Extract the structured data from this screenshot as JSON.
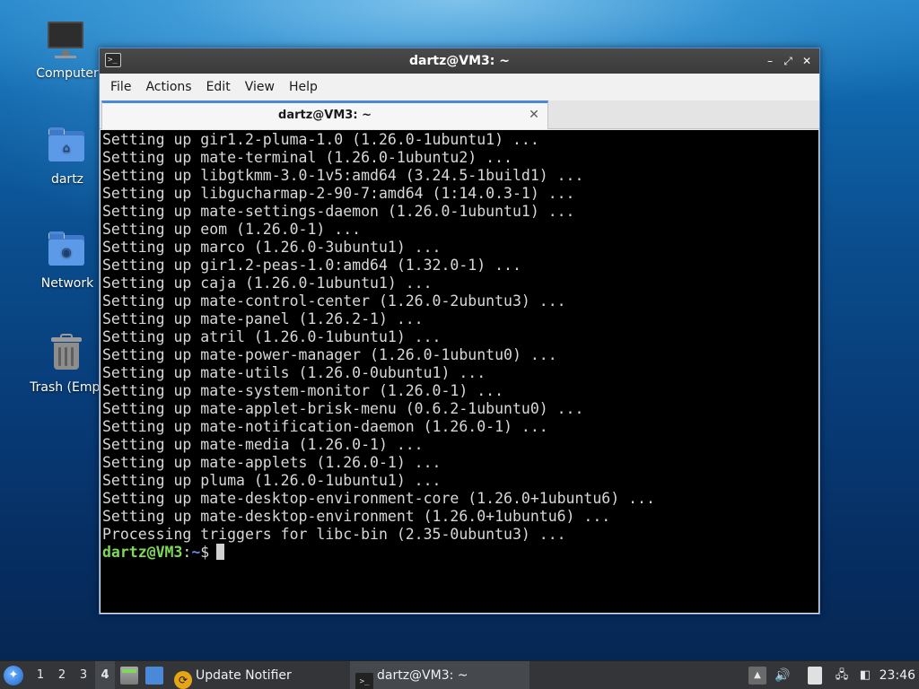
{
  "desktop": {
    "icons": [
      {
        "label": "Computer",
        "icon": "computer-icon"
      },
      {
        "label": "dartz",
        "icon": "home-folder-icon"
      },
      {
        "label": "Network",
        "icon": "network-folder-icon"
      },
      {
        "label": "Trash (Empt",
        "icon": "trash-icon"
      }
    ]
  },
  "window": {
    "title": "dartz@VM3: ~",
    "controls": {
      "minimize": "–",
      "maximize": "⤢",
      "close": "✕"
    },
    "menu": [
      "File",
      "Actions",
      "Edit",
      "View",
      "Help"
    ],
    "tab": {
      "label": "dartz@VM3: ~",
      "close": "✕"
    }
  },
  "terminal": {
    "lines": [
      "Setting up gir1.2-pluma-1.0 (1.26.0-1ubuntu1) ...",
      "Setting up mate-terminal (1.26.0-1ubuntu2) ...",
      "Setting up libgtkmm-3.0-1v5:amd64 (3.24.5-1build1) ...",
      "Setting up libgucharmap-2-90-7:amd64 (1:14.0.3-1) ...",
      "Setting up mate-settings-daemon (1.26.0-1ubuntu1) ...",
      "Setting up eom (1.26.0-1) ...",
      "Setting up marco (1.26.0-3ubuntu1) ...",
      "Setting up gir1.2-peas-1.0:amd64 (1.32.0-1) ...",
      "Setting up caja (1.26.0-1ubuntu1) ...",
      "Setting up mate-control-center (1.26.0-2ubuntu3) ...",
      "Setting up mate-panel (1.26.2-1) ...",
      "Setting up atril (1.26.0-1ubuntu1) ...",
      "Setting up mate-power-manager (1.26.0-1ubuntu0) ...",
      "Setting up mate-utils (1.26.0-0ubuntu1) ...",
      "Setting up mate-system-monitor (1.26.0-1) ...",
      "Setting up mate-applet-brisk-menu (0.6.2-1ubuntu0) ...",
      "Setting up mate-notification-daemon (1.26.0-1) ...",
      "Setting up mate-media (1.26.0-1) ...",
      "Setting up mate-applets (1.26.0-1) ...",
      "Setting up pluma (1.26.0-1ubuntu1) ...",
      "Setting up mate-desktop-environment-core (1.26.0+1ubuntu6) ...",
      "Setting up mate-desktop-environment (1.26.0+1ubuntu6) ...",
      "Processing triggers for libc-bin (2.35-0ubuntu3) ..."
    ],
    "prompt": {
      "user_host": "dartz@VM3",
      "colon": ":",
      "path": "~",
      "symbol": "$"
    }
  },
  "panel": {
    "workspaces": [
      "1",
      "2",
      "3",
      "4"
    ],
    "active_workspace": "4",
    "tasks": [
      {
        "label": "Update Notifier",
        "icon": "update-notifier-icon"
      },
      {
        "label": "dartz@VM3: ~",
        "icon": "terminal-icon"
      }
    ],
    "clock": "23:46"
  },
  "colors": {
    "terminal_bg": "#000000",
    "terminal_fg": "#d8d8d8",
    "prompt_user": "#7ed957",
    "prompt_path": "#5a8fe0",
    "accent": "#4a89d8"
  }
}
